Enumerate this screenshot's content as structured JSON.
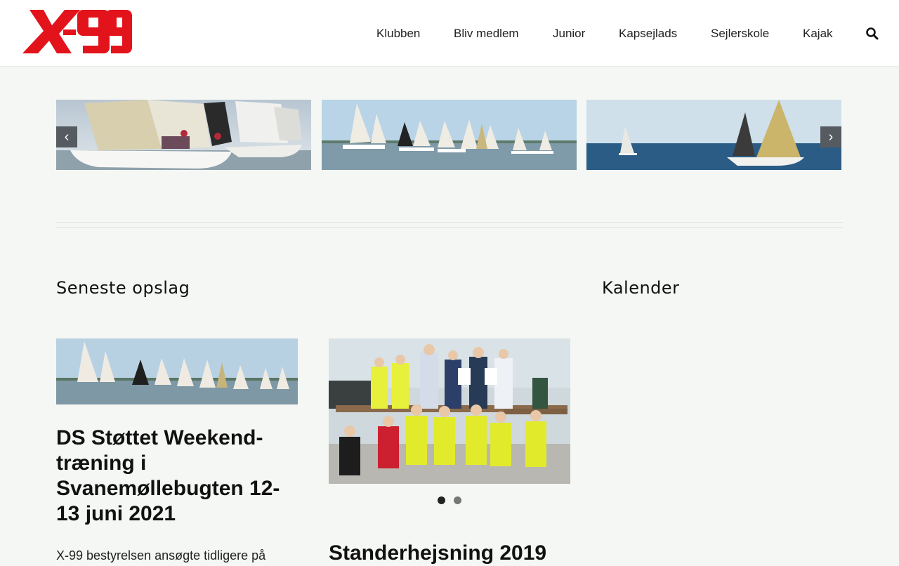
{
  "site": {
    "logo_text": "X-99",
    "brand_color": "#e3131b"
  },
  "nav": {
    "items": [
      {
        "label": "Klubben"
      },
      {
        "label": "Bliv medlem"
      },
      {
        "label": "Junior"
      },
      {
        "label": "Kapsejlads"
      },
      {
        "label": "Sejlerskole"
      },
      {
        "label": "Kajak"
      }
    ],
    "search_icon": "search-icon"
  },
  "slider": {
    "prev_icon": "chevron-left-icon",
    "next_icon": "chevron-right-icon",
    "prev_glyph": "‹",
    "next_glyph": "›"
  },
  "sections": {
    "latest_posts_title": "Seneste opslag",
    "calendar_title": "Kalender"
  },
  "posts": [
    {
      "title": "DS Støttet Weekend-træning i Svanemøllebugten 12-13 juni 2021",
      "excerpt": "X-99 bestyrelsen ansøgte tidligere på"
    },
    {
      "title": "Standerhejsning 2019"
    }
  ],
  "carousel_dots": {
    "active_index": 0,
    "count": 2,
    "active_color": "#222222",
    "inactive_color": "#777777"
  }
}
